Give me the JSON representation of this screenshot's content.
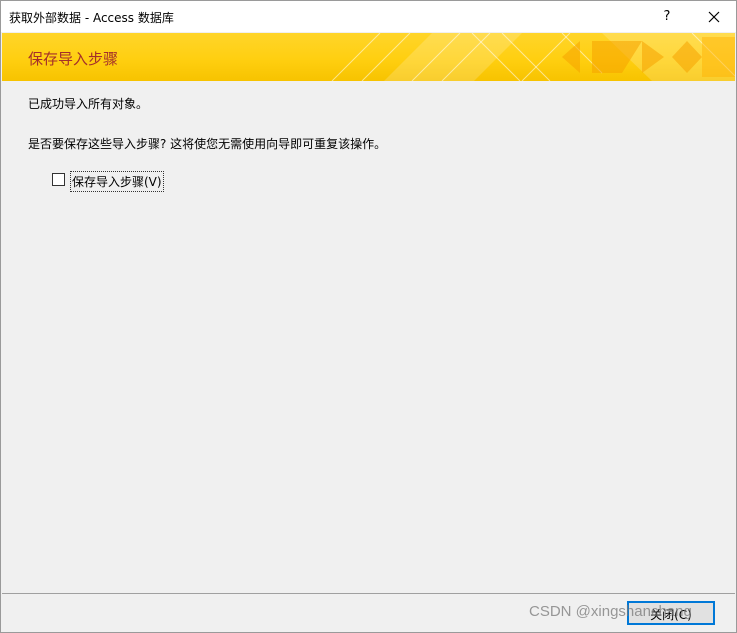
{
  "window": {
    "title": "获取外部数据 - Access 数据库",
    "help_label": "?",
    "close_icon": "close-icon"
  },
  "banner": {
    "heading": "保存导入步骤",
    "colors": {
      "accent": "#ffcc00",
      "heading_text": "#a4302a"
    }
  },
  "content": {
    "success_message": "已成功导入所有对象。",
    "prompt": "是否要保存这些导入步骤? 这将使您无需使用向导即可重复该操作。",
    "save_steps_checkbox": {
      "label": "保存导入步骤(V)",
      "checked": false
    }
  },
  "footer": {
    "close_button_label": "关闭(C)"
  },
  "watermark": "CSDN @xingshanchang"
}
